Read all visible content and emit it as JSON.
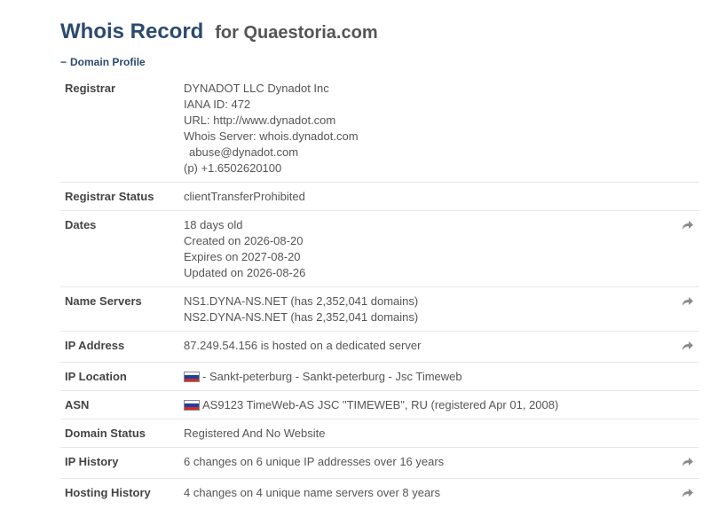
{
  "header": {
    "title": "Whois Record",
    "for_text": "for Quaestoria.com"
  },
  "section": {
    "toggle": "−",
    "label": "Domain Profile"
  },
  "registrar": {
    "label": "Registrar",
    "lines": [
      "DYNADOT LLC Dynadot Inc",
      "IANA ID: 472",
      "URL: http://www.dynadot.com",
      "Whois Server: whois.dynadot.com",
      "abuse@dynadot.com",
      "(p) +1.6502620100"
    ]
  },
  "registrar_status": {
    "label": "Registrar Status",
    "value": "clientTransferProhibited"
  },
  "dates": {
    "label": "Dates",
    "lines": [
      "18 days old",
      "Created on 2026-08-20",
      "Expires on 2027-08-20",
      "Updated on 2026-08-26"
    ]
  },
  "name_servers": {
    "label": "Name Servers",
    "lines": [
      "NS1.DYNA-NS.NET (has 2,352,041 domains)",
      "NS2.DYNA-NS.NET (has 2,352,041 domains)"
    ]
  },
  "ip_address": {
    "label": "IP Address",
    "value": "87.249.54.156 is hosted on a dedicated server"
  },
  "ip_location": {
    "label": "IP Location",
    "value": "- Sankt-peterburg - Sankt-peterburg - Jsc Timeweb",
    "flag": "russia-flag"
  },
  "asn": {
    "label": "ASN",
    "value": "AS9123 TimeWeb-AS JSC \"TIMEWEB\", RU (registered Apr 01, 2008)",
    "flag": "russia-flag"
  },
  "domain_status": {
    "label": "Domain Status",
    "value": "Registered And No Website"
  },
  "ip_history": {
    "label": "IP History",
    "value": "6 changes on 6 unique IP addresses over 16 years"
  },
  "hosting_history": {
    "label": "Hosting History",
    "value": "4 changes on 4 unique name servers over 8 years"
  },
  "icons": {
    "action": "share-arrow-icon"
  },
  "colors": {
    "title": "#2b4a6f",
    "border": "#e8e8e8",
    "arrow": "#8a8a8a"
  }
}
